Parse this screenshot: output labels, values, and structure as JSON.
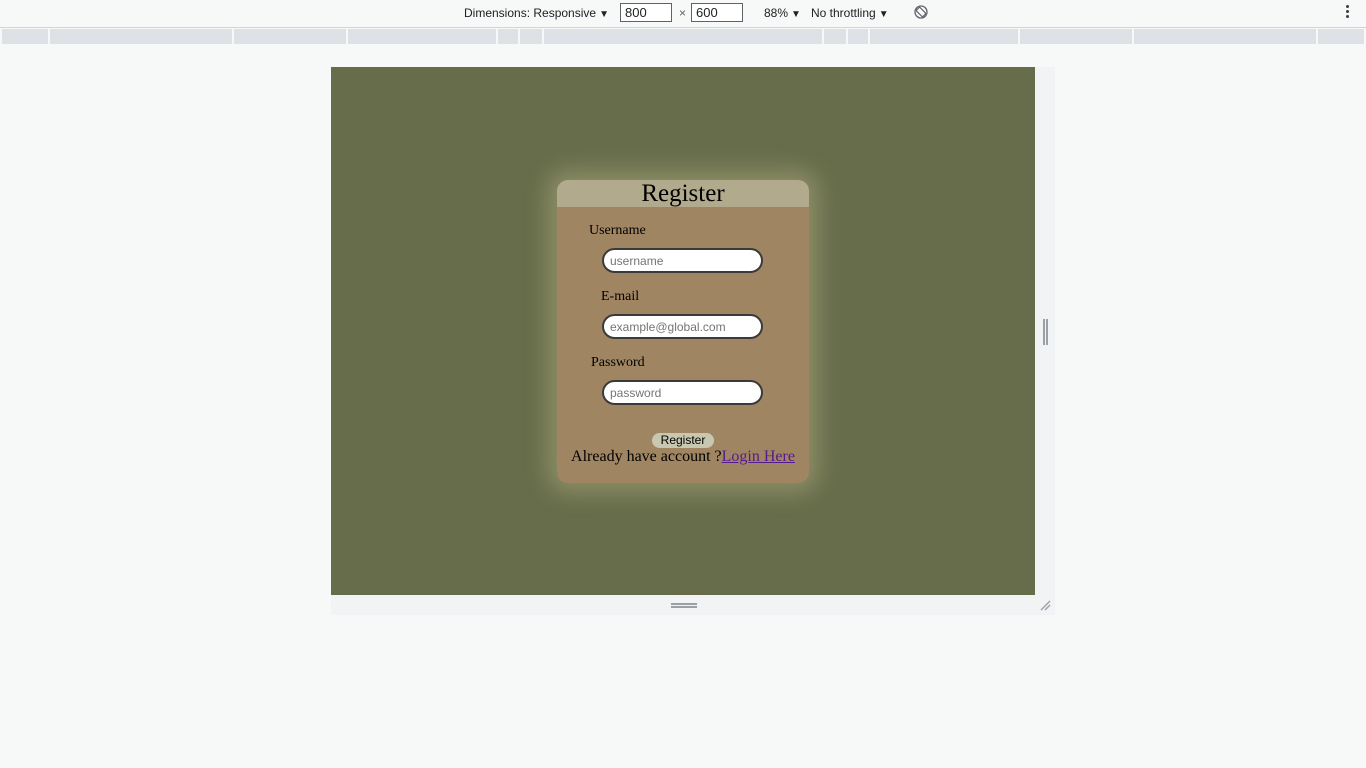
{
  "devtools": {
    "dimensions_label": "Dimensions: Responsive",
    "width_value": "800",
    "height_value": "600",
    "times_symbol": "×",
    "zoom_label": "88%",
    "throttling_label": "No throttling",
    "caret": "▼"
  },
  "page": {
    "background_color": "#676d4b",
    "card_color": "#a08562",
    "card_header_color": "#b2aa8c"
  },
  "register_form": {
    "title": "Register",
    "username_label": "Username",
    "username_placeholder": "username",
    "email_label": "E-mail",
    "email_placeholder": "example@global.com",
    "password_label": "Password",
    "password_placeholder": "password",
    "submit_label": "Register",
    "login_prompt": "Already have account ?",
    "login_link": "Login Here"
  }
}
